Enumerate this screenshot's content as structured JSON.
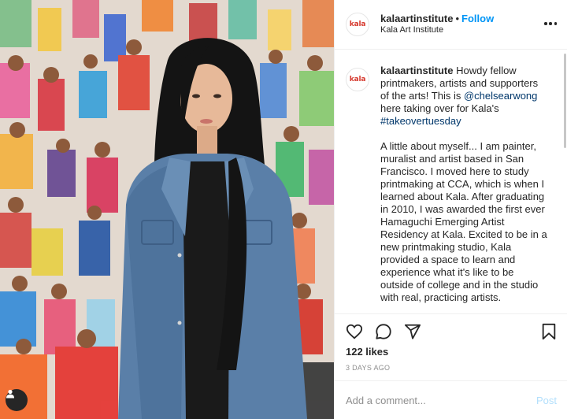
{
  "header": {
    "logo_text": "kala",
    "username": "kalaartinstitute",
    "separator": "•",
    "follow_label": "Follow",
    "subtitle": "Kala Art Institute"
  },
  "caption": {
    "logo_text": "kala",
    "username": "kalaartinstitute",
    "intro_before": "Howdy fellow printmakers, artists and supporters of the arts! This is",
    "mention": "@chelsearwong",
    "intro_after": "here taking over for Kala's",
    "hashtag": "#takeovertuesday",
    "body": "A little about myself... I am painter, muralist and artist based in San Francisco. I moved here to study printmaking at CCA, which is when I learned about Kala. After graduating in 2010, I was awarded the first ever Hamaguchi Emerging Artist Residency at Kala. Excited to be in a new printmaking studio, Kala provided a space to learn and experience what it's like to be outside of college and in the studio with real, practicing artists."
  },
  "actions": {
    "likes": "122 likes",
    "time": "3 DAYS AGO",
    "comment_placeholder": "Add a comment...",
    "post_label": "Post"
  },
  "icons": [
    "heart-icon",
    "comment-icon",
    "share-icon",
    "bookmark-icon",
    "more-icon",
    "user-tag-icon"
  ],
  "colors": {
    "accent": "#0095f6",
    "brand": "#d63a2f",
    "link": "#00376b",
    "muted": "#8e8e8e"
  }
}
